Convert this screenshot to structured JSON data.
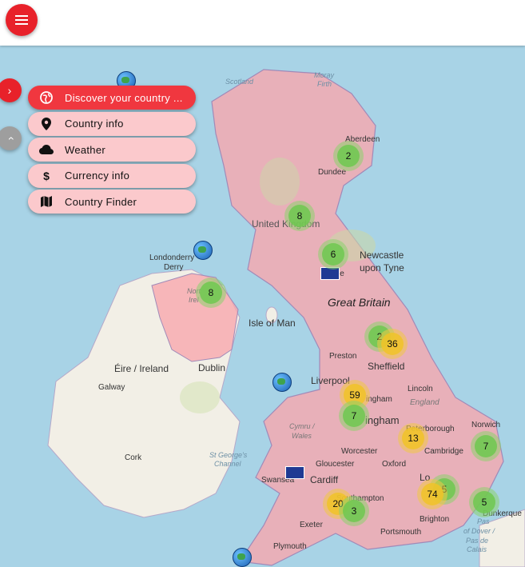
{
  "menu": {
    "items": [
      {
        "label": "Discover your country ...",
        "icon": "globe-icon",
        "active": true
      },
      {
        "label": "Country info",
        "icon": "map-pin-icon",
        "active": false
      },
      {
        "label": "Weather",
        "icon": "cloud-icon",
        "active": false
      },
      {
        "label": "Currency info",
        "icon": "dollar-icon",
        "active": false
      },
      {
        "label": "Country Finder",
        "icon": "map-icon",
        "active": false
      }
    ]
  },
  "colors": {
    "accent": "#e8212a",
    "highlight": "#f8a8ae",
    "sea": "#a8d3e6",
    "land": "#f2efe6",
    "cluster_green": "#6ec850",
    "cluster_yellow": "#f0c328"
  },
  "map": {
    "labels": {
      "scotland": "Scotland",
      "moray": "Moray",
      "firth": "Firth",
      "aberdeen": "Aberdeen",
      "dundee": "Dundee",
      "uk": "United Kingdom",
      "londonderry": "Londonderry",
      "derry": "Derry",
      "northern": "Nort",
      "ireland_ni": "Irel",
      "newcastle": "Newcastle",
      "upon_tyne": "upon Tyne",
      "carlisle": "sle",
      "great_britain": "Great Britain",
      "isle_of_man": "Isle of Man",
      "eire": "Éire / Ireland",
      "dublin": "Dublin",
      "galway": "Galway",
      "cork": "Cork",
      "preston": "Preston",
      "sheffield": "Sheffield",
      "liverpool": "Liverpool",
      "nottingham": "ingham",
      "lincoln": "Lincoln",
      "england": "England",
      "birmingham": "ingham",
      "peterborough": "Peterborough",
      "norwich": "Norwich",
      "cymru": "Cymru /",
      "wales": "Wales",
      "worcester": "Worcester",
      "cambridge": "Cambridge",
      "gloucester": "Gloucester",
      "oxford": "Oxford",
      "stgeorges1": "St George's",
      "stgeorges2": "Channel",
      "swansea": "Swansea",
      "cardiff": "Cardiff",
      "london": "Lo",
      "southampton": "Southampton",
      "exeter": "Exeter",
      "portsmouth": "Portsmouth",
      "brighton": "Brighton",
      "dunkerque": "Dunkerque",
      "strait1": "Pas",
      "strait0": "of Dover /",
      "strait2": "Pas de",
      "strait3": "Calais",
      "plymouth": "Plymouth"
    },
    "clusters": [
      {
        "count": "2",
        "color": "green"
      },
      {
        "count": "8",
        "color": "green"
      },
      {
        "count": "6",
        "color": "green"
      },
      {
        "count": "8",
        "color": "green"
      },
      {
        "count": "2",
        "color": "green"
      },
      {
        "count": "36",
        "color": "yellow"
      },
      {
        "count": "59",
        "color": "yellow"
      },
      {
        "count": "7",
        "color": "green"
      },
      {
        "count": "13",
        "color": "yellow"
      },
      {
        "count": "7",
        "color": "green"
      },
      {
        "count": "5",
        "color": "green"
      },
      {
        "count": "74",
        "color": "yellow"
      },
      {
        "count": "5",
        "color": "green"
      },
      {
        "count": "20",
        "color": "yellow"
      },
      {
        "count": "3",
        "color": "green"
      }
    ]
  }
}
